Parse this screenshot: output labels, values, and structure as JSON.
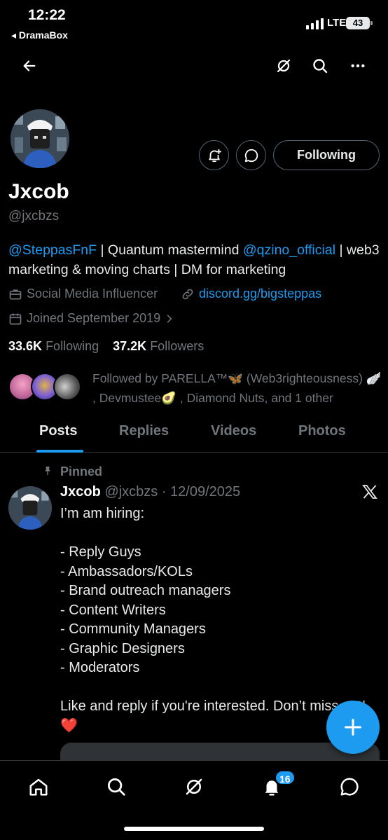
{
  "status_bar": {
    "time": "12:22",
    "back_app": "◂ DramaBox",
    "network": "LTE",
    "battery": "43"
  },
  "profile": {
    "name": "Jxcob",
    "handle": "@jxcbzs",
    "follow_label": "Following",
    "bio": {
      "mention1": "@SteppasFnF",
      "text1": " | Quantum mastermind ",
      "mention2": "@qzino_official",
      "text2": " | web3 marketing & moving charts | DM for marketing"
    },
    "category": "Social Media Influencer",
    "link": "discord.gg/bigsteppas",
    "joined": "Joined September 2019",
    "following_count": "33.6K",
    "following_label": "Following",
    "followers_count": "37.2K",
    "followers_label": "Followers",
    "followed_by": "Followed by PARELLA™🦋 (Web3righteousness) 🪽 , Devmustee🥑 , Diamond Nuts, and 1 other"
  },
  "tabs": [
    {
      "label": "Posts",
      "active": true
    },
    {
      "label": "Replies"
    },
    {
      "label": "Videos"
    },
    {
      "label": "Photos"
    }
  ],
  "post": {
    "pinned_label": "Pinned",
    "author": "Jxcob",
    "handle_date": "@jxcbzs · 12/09/2025",
    "body": "I’m am hiring:\n\n- Reply Guys\n- Ambassadors/KOLs\n- Brand outreach managers\n- Content Writers\n- Community Managers\n- Graphic Designers\n- Moderators\n\nLike and reply if you're interested. Don’t miss out! ❤️"
  },
  "notifications_badge": "16",
  "colors": {
    "accent": "#1d9bf0",
    "background": "#000000",
    "muted": "#71767b"
  }
}
